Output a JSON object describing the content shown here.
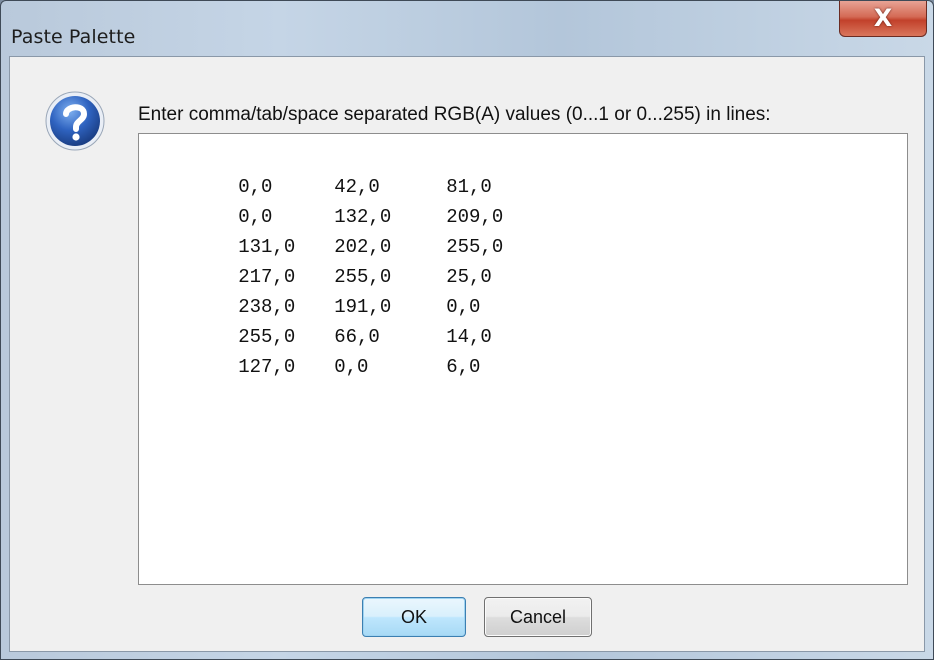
{
  "window": {
    "title": "Paste Palette",
    "close_glyph": "X"
  },
  "dialog": {
    "icon": "question-icon",
    "prompt": "Enter comma/tab/space separated RGB(A) values (0...1 or 0...255) in lines:",
    "rows": [
      [
        "0,0",
        "42,0",
        "81,0"
      ],
      [
        "0,0",
        "132,0",
        "209,0"
      ],
      [
        "131,0",
        "202,0",
        "255,0"
      ],
      [
        "217,0",
        "255,0",
        "25,0"
      ],
      [
        "238,0",
        "191,0",
        "0,0"
      ],
      [
        "255,0",
        "66,0",
        "14,0"
      ],
      [
        "127,0",
        "0,0",
        "6,0"
      ]
    ]
  },
  "buttons": {
    "ok_label": "OK",
    "cancel_label": "Cancel"
  },
  "colors": {
    "dialog_background": "#f0f0f0",
    "close_button": "#c2412b",
    "ok_border": "#3c7fb1",
    "question_icon": "#2a5bb0"
  }
}
